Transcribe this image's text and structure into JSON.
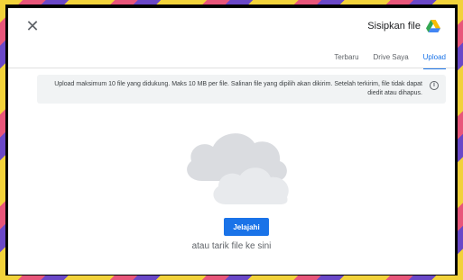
{
  "dialog": {
    "title": "Sisipkan file",
    "close_icon": "close-icon",
    "logo_icon": "google-drive-icon"
  },
  "tabs": [
    {
      "label": "Upload",
      "active": true
    },
    {
      "label": "Drive Saya",
      "active": false
    },
    {
      "label": "Terbaru",
      "active": false
    }
  ],
  "notice": {
    "icon": "info-icon",
    "text": "Upload maksimum 10 file yang didukung. Maks 10 MB per file. Salinan file yang dipilih akan dikirim. Setelah terkirim, file tidak dapat diedit atau dihapus."
  },
  "upload": {
    "illustration": "cloud-illustration",
    "button_label": "Jelajahi",
    "drop_hint": "atau tarik file ke sini"
  },
  "colors": {
    "accent": "#1a73e8",
    "notice_bg": "#f1f3f4"
  }
}
